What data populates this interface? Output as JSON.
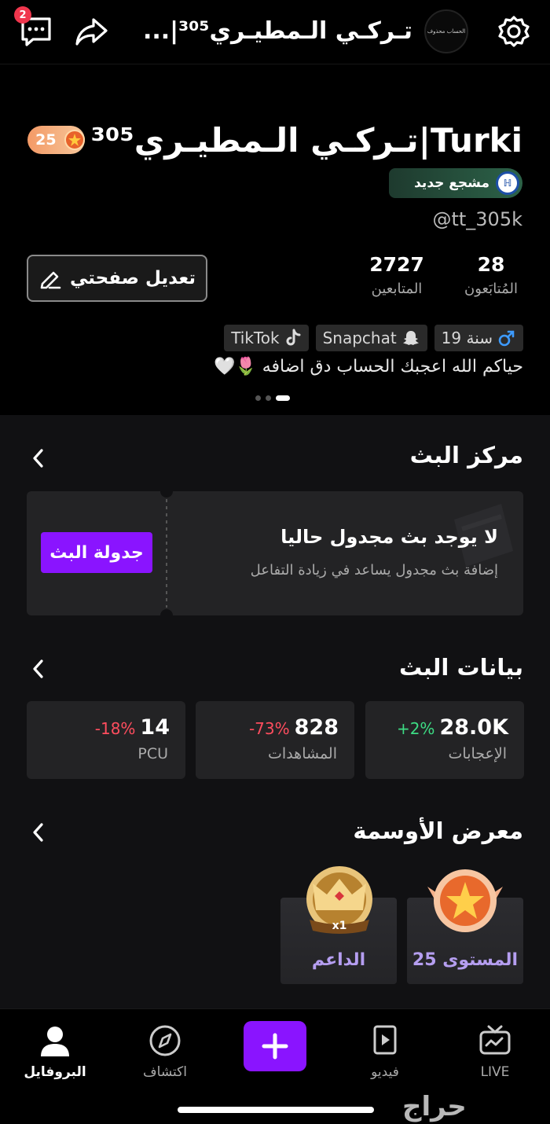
{
  "topbar": {
    "message_badge": "2",
    "title": "تـركـي الـمطيـري³⁰⁵|...",
    "avatar_text": "الحساب محذوف"
  },
  "profile": {
    "level": "25",
    "display_name": "تـركـي الـمطيـري³⁰⁵|Turki",
    "fan_badge": "مشجع جديد",
    "handle": "@tt_305k",
    "edit_button": "تعديل صفحتي",
    "following_count": "28",
    "following_label": "المُتابَعون",
    "followers_count": "2727",
    "followers_label": "المتابعين",
    "tags": [
      {
        "icon": "male-icon",
        "text": "19 سنة"
      },
      {
        "icon": "snapchat-icon",
        "text": "Snapchat"
      },
      {
        "icon": "tiktok-icon",
        "text": "TikTok"
      }
    ],
    "bio": "حياكم الله اعجبك الحساب دق اضافه 🌷🤍"
  },
  "stream_center": {
    "title": "مركز البث",
    "card_title": "لا يوجد بث مجدول حاليا",
    "card_subtitle": "إضافة بث مجدول يساعد في زيادة التفاعل",
    "schedule_button": "جدولة البث"
  },
  "stream_data": {
    "title": "بيانات البث",
    "metrics": [
      {
        "value": "28.0K",
        "change": "+2%",
        "change_color": "#3ddc84",
        "label": "الإعجابات"
      },
      {
        "value": "828",
        "change": "-73%",
        "change_color": "#ff4d5e",
        "label": "المشاهدات"
      },
      {
        "value": "14",
        "change": "-18%",
        "change_color": "#ff4d5e",
        "label": "PCU"
      }
    ]
  },
  "medals": {
    "title": "معرض الأوسمة",
    "items": [
      {
        "label": "المستوى 25"
      },
      {
        "label": "الداعم",
        "multiplier": "x1"
      }
    ]
  },
  "nav": {
    "live": "LIVE",
    "video": "فيديو",
    "explore": "اكتشاف",
    "profile": "البروفايل"
  },
  "watermark": "حراج",
  "colors": {
    "accent": "#8a14ff",
    "badge_red": "#f0364d"
  }
}
